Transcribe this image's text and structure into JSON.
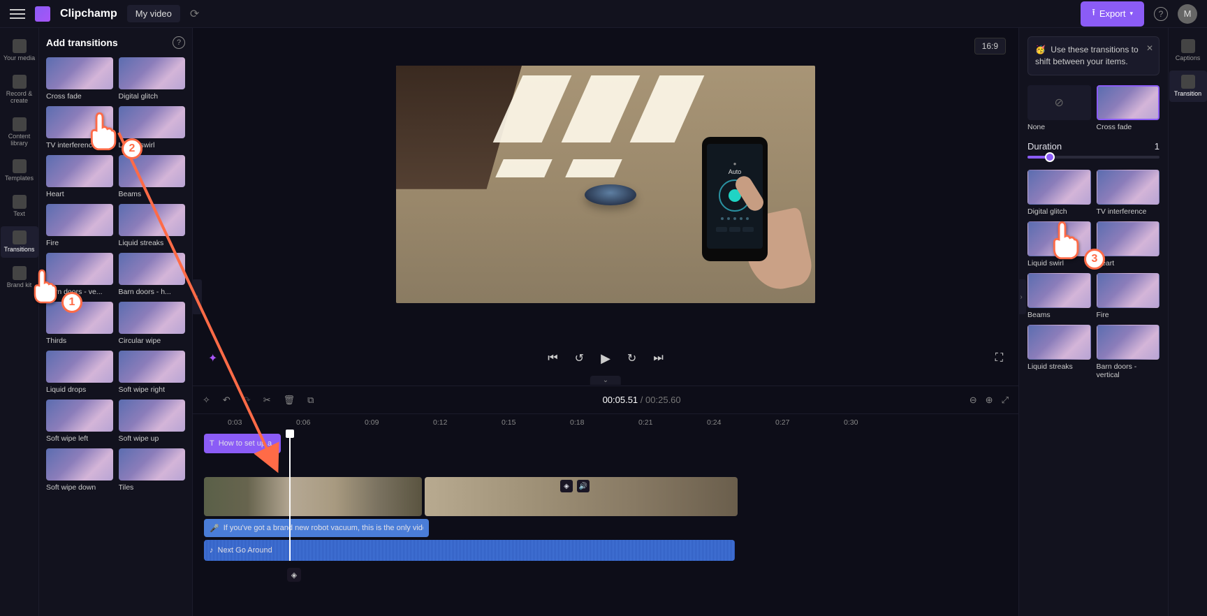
{
  "header": {
    "brand": "Clipchamp",
    "project_name": "My video",
    "export_label": "Export",
    "avatar_initial": "M"
  },
  "left_rail": [
    {
      "id": "your-media",
      "label": "Your media"
    },
    {
      "id": "record-create",
      "label": "Record & create"
    },
    {
      "id": "content-library",
      "label": "Content library"
    },
    {
      "id": "templates",
      "label": "Templates"
    },
    {
      "id": "text",
      "label": "Text"
    },
    {
      "id": "transitions",
      "label": "Transitions",
      "active": true
    },
    {
      "id": "brand-kit",
      "label": "Brand kit"
    }
  ],
  "right_rail": [
    {
      "id": "captions",
      "label": "Captions"
    },
    {
      "id": "transition",
      "label": "Transition",
      "active": true
    }
  ],
  "panel": {
    "title": "Add transitions",
    "items": [
      {
        "id": "cross-fade",
        "label": "Cross fade"
      },
      {
        "id": "digital-glitch",
        "label": "Digital glitch"
      },
      {
        "id": "tv-interference",
        "label": "TV interference"
      },
      {
        "id": "liquid-swirl",
        "label": "Liquid swirl"
      },
      {
        "id": "heart",
        "label": "Heart"
      },
      {
        "id": "beams",
        "label": "Beams"
      },
      {
        "id": "fire",
        "label": "Fire"
      },
      {
        "id": "liquid-streaks",
        "label": "Liquid streaks"
      },
      {
        "id": "barn-doors-vertical",
        "label": "Barn doors - ve..."
      },
      {
        "id": "barn-doors-horizontal",
        "label": "Barn doors - h..."
      },
      {
        "id": "thirds",
        "label": "Thirds"
      },
      {
        "id": "circular-wipe",
        "label": "Circular wipe"
      },
      {
        "id": "liquid-drops",
        "label": "Liquid drops"
      },
      {
        "id": "soft-wipe-right",
        "label": "Soft wipe right"
      },
      {
        "id": "soft-wipe-left",
        "label": "Soft wipe left"
      },
      {
        "id": "soft-wipe-up",
        "label": "Soft wipe up"
      },
      {
        "id": "soft-wipe-down",
        "label": "Soft wipe down"
      },
      {
        "id": "tiles",
        "label": "Tiles"
      }
    ]
  },
  "preview": {
    "aspect": "16:9",
    "current_time": "00:05.51",
    "total_time": "00:25.60",
    "phone_mode": "Auto"
  },
  "timeline": {
    "ticks": [
      "0:03",
      "0:06",
      "0:09",
      "0:12",
      "0:15",
      "0:18",
      "0:21",
      "0:24",
      "0:27",
      "0:30"
    ],
    "title_clip": "How to set up a",
    "subtitle_clip": "If you've got a brand new robot vacuum, this is the only vide",
    "music_clip": "Next Go Around"
  },
  "props": {
    "tip": "Use these transitions to shift between your items.",
    "duration_label": "Duration",
    "duration_value": "1",
    "items": [
      {
        "id": "none",
        "label": "None",
        "none": true
      },
      {
        "id": "cross-fade",
        "label": "Cross fade",
        "selected": true
      },
      {
        "id": "digital-glitch",
        "label": "Digital glitch"
      },
      {
        "id": "tv-interference",
        "label": "TV interference"
      },
      {
        "id": "liquid-swirl",
        "label": "Liquid swirl"
      },
      {
        "id": "heart",
        "label": "Heart"
      },
      {
        "id": "beams",
        "label": "Beams"
      },
      {
        "id": "fire",
        "label": "Fire"
      },
      {
        "id": "liquid-streaks",
        "label": "Liquid streaks"
      },
      {
        "id": "barn-doors-vertical",
        "label": "Barn doors - vertical"
      }
    ]
  },
  "annotations": {
    "b1": "1",
    "b2": "2",
    "b3": "3"
  }
}
